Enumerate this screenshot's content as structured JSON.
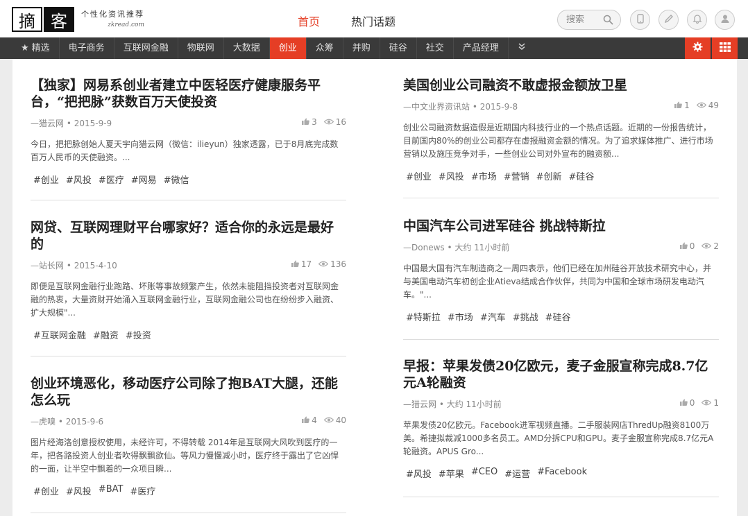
{
  "header": {
    "logo_char1": "摘",
    "logo_char2": "客",
    "slogan": "个性化资讯推荐",
    "domain": "zkread.com",
    "nav": [
      {
        "label": "首页"
      },
      {
        "label": "热门话题"
      }
    ],
    "search_placeholder": "搜索"
  },
  "categories": [
    {
      "label": "精选"
    },
    {
      "label": "电子商务"
    },
    {
      "label": "互联网金融"
    },
    {
      "label": "物联网"
    },
    {
      "label": "大数据"
    },
    {
      "label": "创业"
    },
    {
      "label": "众筹"
    },
    {
      "label": "并购"
    },
    {
      "label": "硅谷"
    },
    {
      "label": "社交"
    },
    {
      "label": "产品经理"
    },
    {
      "label": "»"
    }
  ],
  "active_category": "创业",
  "colors": {
    "accent": "#e53e25",
    "catbar": "#3a3a3a"
  },
  "left_articles": [
    {
      "title": "【独家】网易系创业者建立中医轻医疗健康服务平台，“把把脉”获数百万天使投资",
      "meta": "—猎云网 • 2015-9-9",
      "likes": "3",
      "views": "16",
      "summary": "今日，把把脉创始人夏天宇向猎云网（微信：ilieyun）独家透露，已于8月底完成数百万人民币的天使融资。...",
      "tags": [
        "#创业",
        "#风投",
        "#医疗",
        "#网易",
        "#微信"
      ]
    },
    {
      "title": "网贷、互联网理财平台哪家好？适合你的永远是最好的",
      "meta": "—站长网 • 2015-4-10",
      "likes": "17",
      "views": "136",
      "summary": "即便是互联网金融行业跑路、坏账等事故频繁产生，依然未能阻挡投资者对互联网金融的热衷，大量资财开始涌入互联网金融行业，互联网金融公司也在纷纷步入融资、扩大规模\"...",
      "tags": [
        "#互联网金融",
        "#融资",
        "#投资"
      ]
    },
    {
      "title": "创业环境恶化，移动医疗公司除了抱BAT大腿，还能怎么玩",
      "meta": "—虎嗅 • 2015-9-6",
      "likes": "4",
      "views": "40",
      "summary": "图片经海洛创意授权使用，未经许可，不得转载 2014年是互联网大风吹到医疗的一年，把各路投资人创业者吹得飘飘欲仙。等风力慢慢减小时，医疗终于露出了它凶悍的一面，让半空中飘着的一众项目瞬...",
      "tags": [
        "#创业",
        "#风投",
        "#BAT",
        "#医疗"
      ]
    }
  ],
  "right_articles": [
    {
      "title": "美国创业公司融资不敢虚报金额放卫星",
      "meta": "—中文业界资讯站 • 2015-9-8",
      "likes": "1",
      "views": "49",
      "summary": "创业公司融资数据造假是近期国内科技行业的一个热点话题。近期的一份报告统计，目前国内80%的创业公司都存在虚报融资金额的情况。为了追求媒体推广、进行市场营销以及施压竞争对手，一些创业公司对外宣布的融资额...",
      "tags": [
        "#创业",
        "#风投",
        "#市场",
        "#营销",
        "#创新",
        "#硅谷"
      ]
    },
    {
      "title": "中国汽车公司进军硅谷 挑战特斯拉",
      "meta": "—Donews • 大约 11小时前",
      "likes": "0",
      "views": "2",
      "summary": "中国最大国有汽车制造商之一周四表示，他们已经在加州硅谷开放技术研究中心，并与美国电动汽车初创企业Atieva结成合作伙伴，共同为中国和全球市场研发电动汽车。\"...",
      "tags": [
        "#特斯拉",
        "#市场",
        "#汽车",
        "#挑战",
        "#硅谷"
      ]
    },
    {
      "title": "早报：苹果发债20亿欧元，麦子金服宣称完成8.7亿元A轮融资",
      "meta": "—猎云网 • 大约 11小时前",
      "likes": "0",
      "views": "1",
      "summary": "苹果发债20亿欧元。Facebook进军视频直播。二手服装网店ThredUp融资8100万美。希捷拟裁减1000多名员工。AMD分拆CPU和GPU。麦子金服宣称完成8.7亿元A轮融资。APUS Gro...",
      "tags": [
        "#风投",
        "#苹果",
        "#CEO",
        "#运营",
        "#Facebook"
      ]
    }
  ]
}
